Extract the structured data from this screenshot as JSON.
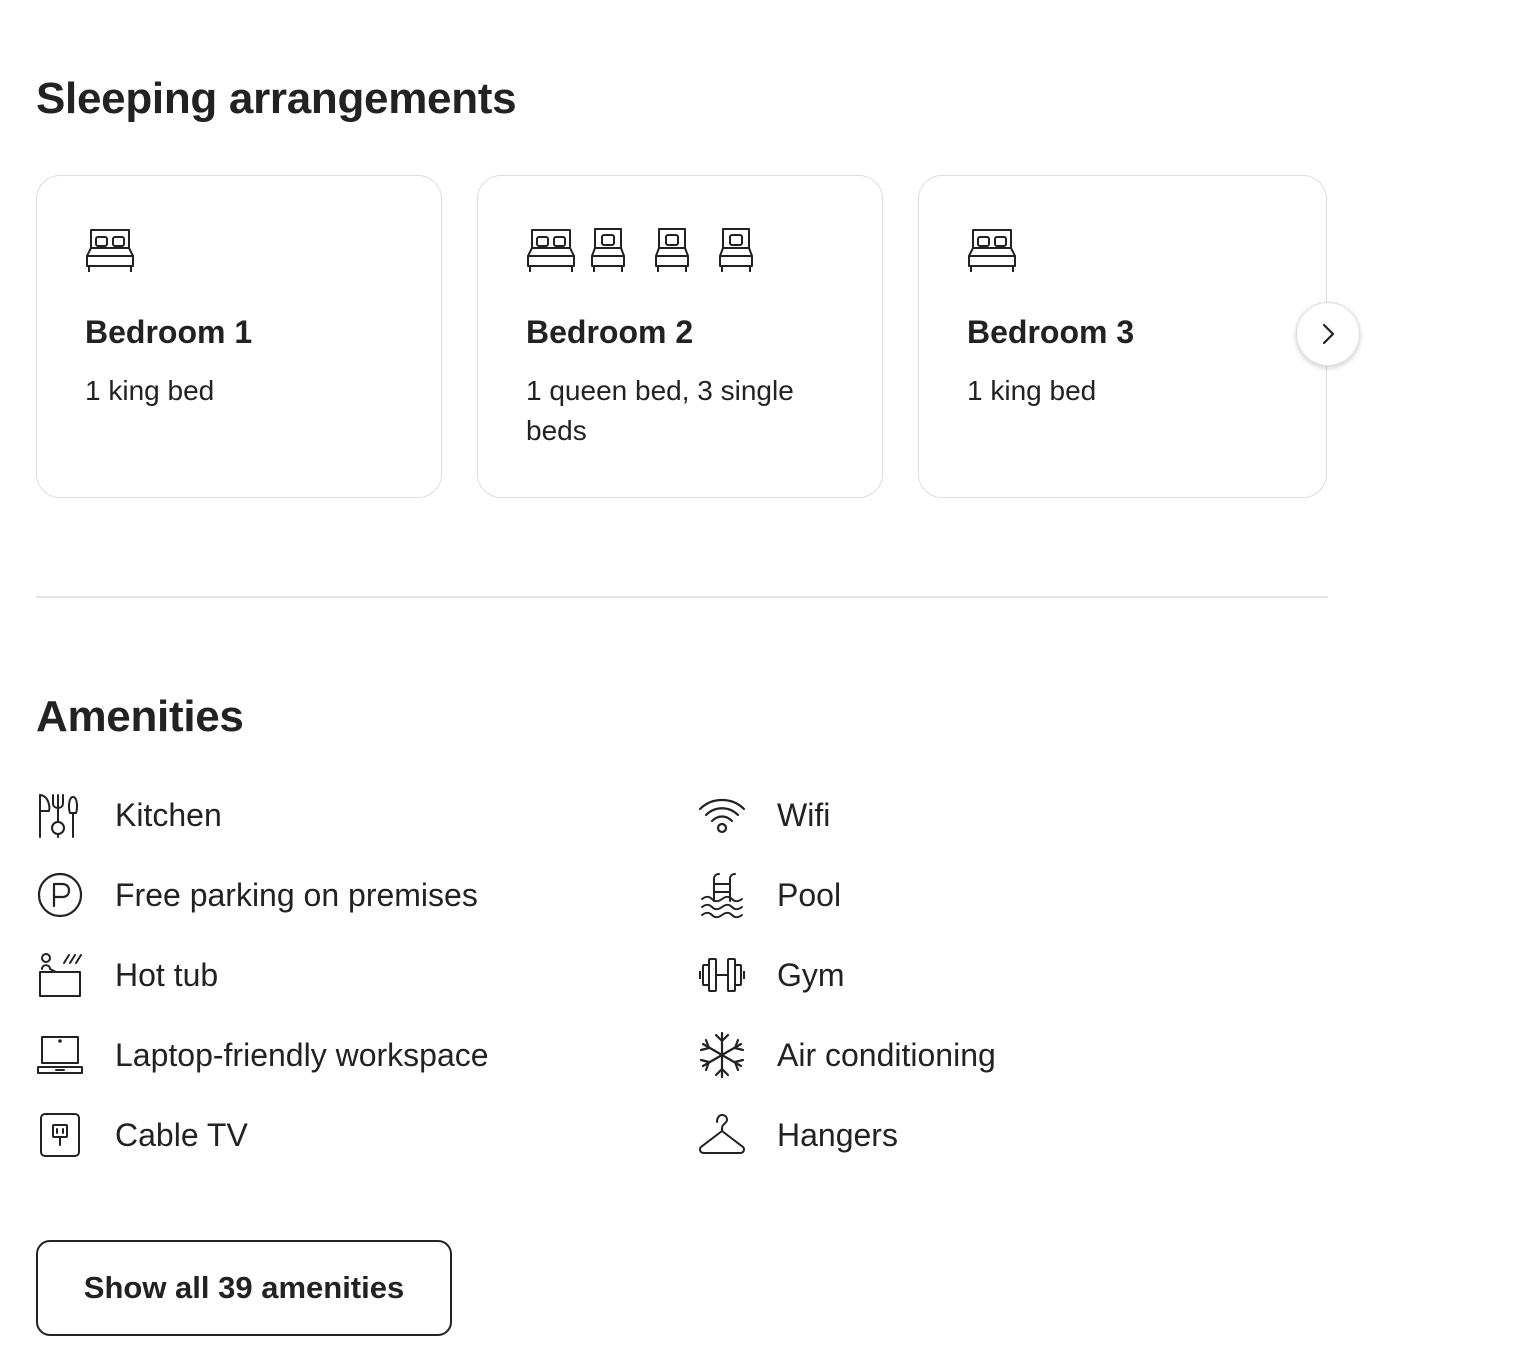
{
  "sleeping": {
    "title": "Sleeping arrangements",
    "bedrooms": [
      {
        "name": "Bedroom 1",
        "beds": "1 king bed",
        "icons": [
          "double-bed-icon"
        ]
      },
      {
        "name": "Bedroom 2",
        "beds": "1 queen bed, 3 single beds",
        "icons": [
          "double-bed-icon",
          "single-bed-icon",
          "single-bed-icon",
          "single-bed-icon"
        ]
      },
      {
        "name": "Bedroom 3",
        "beds": "1 king bed",
        "icons": [
          "double-bed-icon"
        ]
      }
    ],
    "next_icon": "chevron-right-icon"
  },
  "amenities": {
    "title": "Amenities",
    "items": [
      {
        "label": "Kitchen",
        "icon": "kitchen-icon"
      },
      {
        "label": "Wifi",
        "icon": "wifi-icon"
      },
      {
        "label": "Free parking on premises",
        "icon": "parking-icon"
      },
      {
        "label": "Pool",
        "icon": "pool-icon"
      },
      {
        "label": "Hot tub",
        "icon": "hot-tub-icon"
      },
      {
        "label": "Gym",
        "icon": "gym-icon"
      },
      {
        "label": "Laptop-friendly workspace",
        "icon": "laptop-icon"
      },
      {
        "label": "Air conditioning",
        "icon": "snowflake-icon"
      },
      {
        "label": "Cable TV",
        "icon": "tv-icon"
      },
      {
        "label": "Hangers",
        "icon": "hanger-icon"
      }
    ],
    "show_all_label": "Show all 39 amenities"
  },
  "colors": {
    "text": "#222222",
    "border": "#dddddd",
    "divider": "#e4e4e4",
    "background": "#ffffff"
  }
}
